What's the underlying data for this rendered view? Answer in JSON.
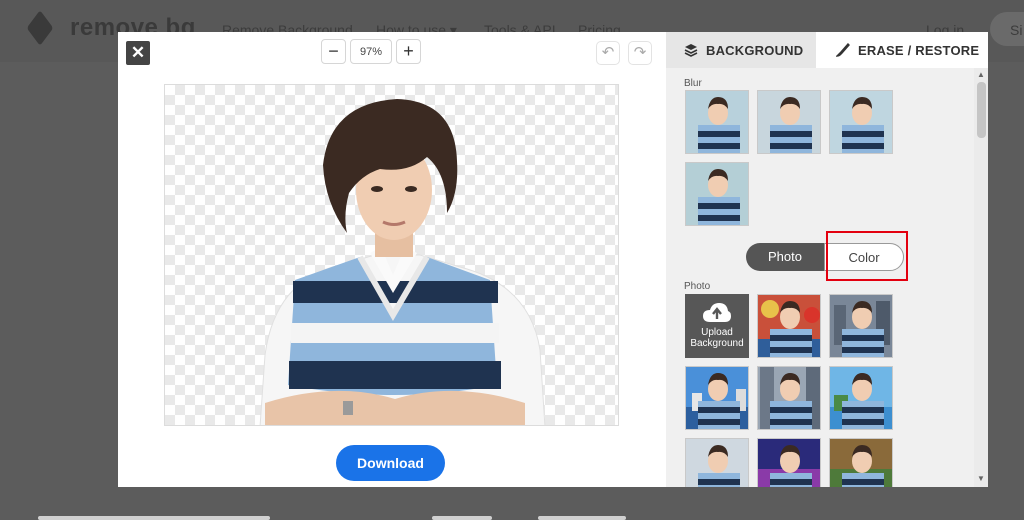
{
  "site": {
    "logo_text": "remove bg",
    "nav": [
      "Remove Background",
      "How to use",
      "Tools & API",
      "Pricing"
    ],
    "login": "Log in",
    "signup": "Si"
  },
  "editor": {
    "close_icon": "close-icon",
    "zoom": {
      "minus": "−",
      "value": "97%",
      "plus": "+"
    },
    "undo_icon": "undo-icon",
    "redo_icon": "redo-icon",
    "download_label": "Download"
  },
  "panel": {
    "tabs": [
      {
        "label": "BACKGROUND",
        "icon": "layers-icon",
        "active": true
      },
      {
        "label": "ERASE / RESTORE",
        "icon": "brush-icon",
        "active": false
      }
    ],
    "blur_label": "Blur",
    "toggle": {
      "photo": "Photo",
      "color": "Color"
    },
    "photo_label": "Photo",
    "upload": {
      "line1": "Upload",
      "line2": "Background"
    }
  },
  "colors": {
    "accent": "#1a73e8",
    "highlight": "#e3000f",
    "toggle_on": "#555555",
    "upload_bg": "#575757"
  }
}
